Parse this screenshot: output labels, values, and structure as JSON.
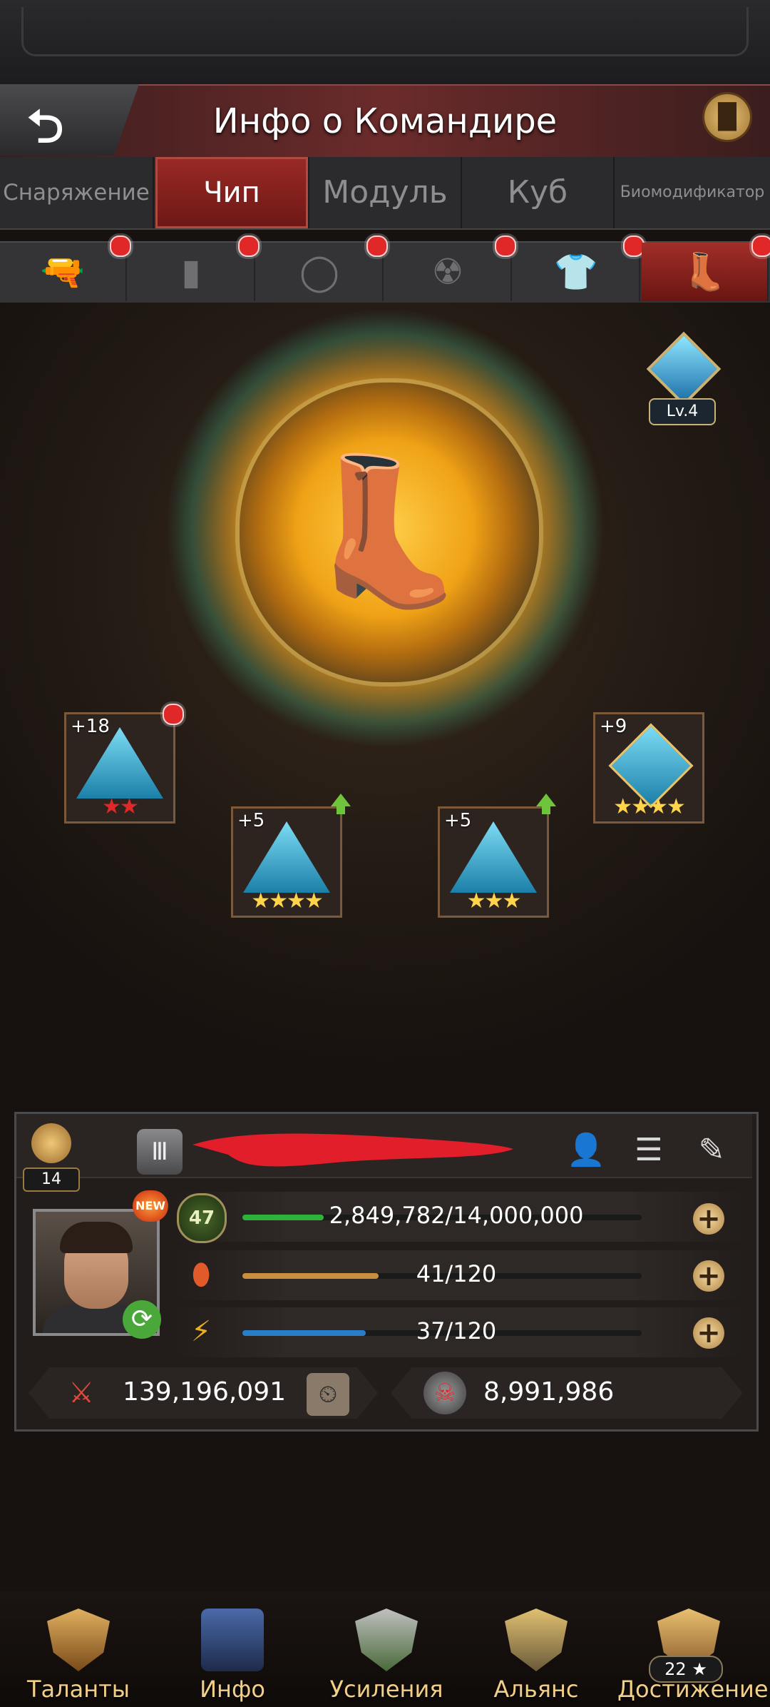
{
  "header": {
    "title": "Инфо о Командире"
  },
  "category_tabs": [
    {
      "label": "Снаряжение",
      "active": false
    },
    {
      "label": "Чип",
      "active": true
    },
    {
      "label": "Модуль",
      "active": false
    },
    {
      "label": "Куб",
      "active": false
    },
    {
      "label": "Биомодификатор",
      "active": false
    }
  ],
  "slot_tabs": [
    {
      "icon": "pistol-icon",
      "glyph": "🔫",
      "notify": true,
      "active": false
    },
    {
      "icon": "armor-vest-icon",
      "glyph": "▮",
      "notify": true,
      "active": false
    },
    {
      "icon": "ring-icon",
      "glyph": "◯",
      "notify": true,
      "active": false
    },
    {
      "icon": "gas-mask-icon",
      "glyph": "☢",
      "notify": true,
      "active": false
    },
    {
      "icon": "jacket-icon",
      "glyph": "👕",
      "notify": true,
      "active": false
    },
    {
      "icon": "boot-icon",
      "glyph": "👢",
      "notify": true,
      "active": true
    }
  ],
  "chip_core": {
    "level": "Lv.4",
    "icon": "boot-icon",
    "glyph": "👢"
  },
  "chips": [
    {
      "level": "+18",
      "stars": "★★",
      "star_color": "red",
      "notify": true,
      "upgrade": false,
      "shape": "triangle"
    },
    {
      "level": "+5",
      "stars": "★★★★",
      "star_color": "gold",
      "notify": false,
      "upgrade": true,
      "shape": "triangle"
    },
    {
      "level": "+5",
      "stars": "★★★",
      "star_color": "gold",
      "notify": false,
      "upgrade": true,
      "shape": "triangle"
    },
    {
      "level": "+9",
      "stars": "★★★★",
      "star_color": "gold",
      "notify": false,
      "upgrade": false,
      "shape": "diamond"
    }
  ],
  "commander": {
    "rank_level": "14",
    "new_badge": "NEW",
    "level": "47",
    "exp_text": "2,849,782/14,000,000",
    "exp_fraction": 0.2036,
    "stamina_text": "41/120",
    "stamina_fraction": 0.3417,
    "energy_text": "37/120",
    "energy_fraction": 0.3083,
    "power": "139,196,091",
    "kills": "8,991,986"
  },
  "nav": [
    {
      "label": "Таланты",
      "icon": "talents-icon"
    },
    {
      "label": "Инфо",
      "icon": "info-icon"
    },
    {
      "label": "Усиления",
      "icon": "boosts-icon"
    },
    {
      "label": "Альянс",
      "icon": "alliance-icon"
    },
    {
      "label": "Достижение",
      "icon": "achievement-icon",
      "count": "22 ★"
    }
  ],
  "colors": {
    "accent_red": "#9a2a26",
    "gold": "#f2cf86",
    "exp_bar": "#2bb33a",
    "stamina_bar": "#c8903e",
    "energy_bar": "#2a7ec8"
  }
}
